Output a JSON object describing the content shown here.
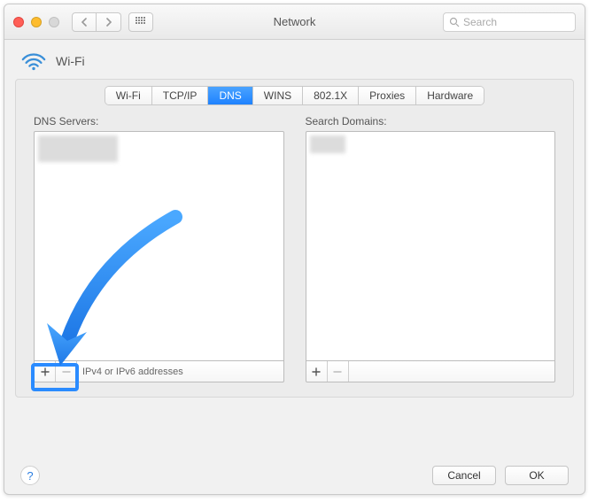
{
  "window": {
    "title": "Network"
  },
  "search": {
    "placeholder": "Search"
  },
  "service": {
    "name": "Wi-Fi"
  },
  "tabs": [
    {
      "label": "Wi-Fi",
      "active": false
    },
    {
      "label": "TCP/IP",
      "active": false
    },
    {
      "label": "DNS",
      "active": true
    },
    {
      "label": "WINS",
      "active": false
    },
    {
      "label": "802.1X",
      "active": false
    },
    {
      "label": "Proxies",
      "active": false
    },
    {
      "label": "Hardware",
      "active": false
    }
  ],
  "dns": {
    "label": "DNS Servers:",
    "footer_hint": "IPv4 or IPv6 addresses"
  },
  "domains": {
    "label": "Search Domains:"
  },
  "buttons": {
    "cancel": "Cancel",
    "ok": "OK"
  }
}
